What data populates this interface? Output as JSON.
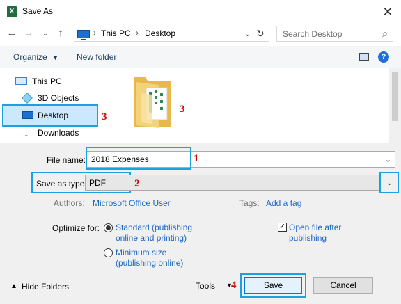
{
  "window": {
    "title": "Save As",
    "app_icon_letter": "X"
  },
  "address": {
    "segments": [
      "This PC",
      "Desktop"
    ]
  },
  "search": {
    "placeholder": "Search Desktop"
  },
  "toolbar": {
    "organize": "Organize",
    "new_folder": "New folder",
    "help": "?"
  },
  "navpane": {
    "items": [
      {
        "label": "This PC",
        "icon": "computer-icon"
      },
      {
        "label": "3D Objects",
        "icon": "cube-icon"
      },
      {
        "label": "Desktop",
        "icon": "desktop-icon",
        "selected": true
      },
      {
        "label": "Downloads",
        "icon": "download-arrow-icon"
      }
    ]
  },
  "form": {
    "file_name_label": "File name:",
    "file_name_value": "2018 Expenses",
    "save_as_type_label": "Save as type:",
    "save_as_type_value": "PDF",
    "authors_label": "Authors:",
    "authors_value": "Microsoft Office User",
    "tags_label": "Tags:",
    "tags_value": "Add a tag",
    "optimize_label": "Optimize for:",
    "option_standard_line1": "Standard (publishing",
    "option_standard_line2": "online and printing)",
    "option_minimum_line1": "Minimum size",
    "option_minimum_line2": "(publishing online)",
    "open_after_line1": "Open file after",
    "open_after_line2": "publishing"
  },
  "footer": {
    "hide_folders": "Hide Folders",
    "tools": "Tools",
    "save": "Save",
    "cancel": "Cancel"
  },
  "annotations": {
    "n1": "1",
    "n2": "2",
    "n3": "3",
    "n4": "4"
  },
  "colors": {
    "highlight": "#1ba0e2",
    "annotation": "#d10000",
    "link": "#1b66c7"
  }
}
